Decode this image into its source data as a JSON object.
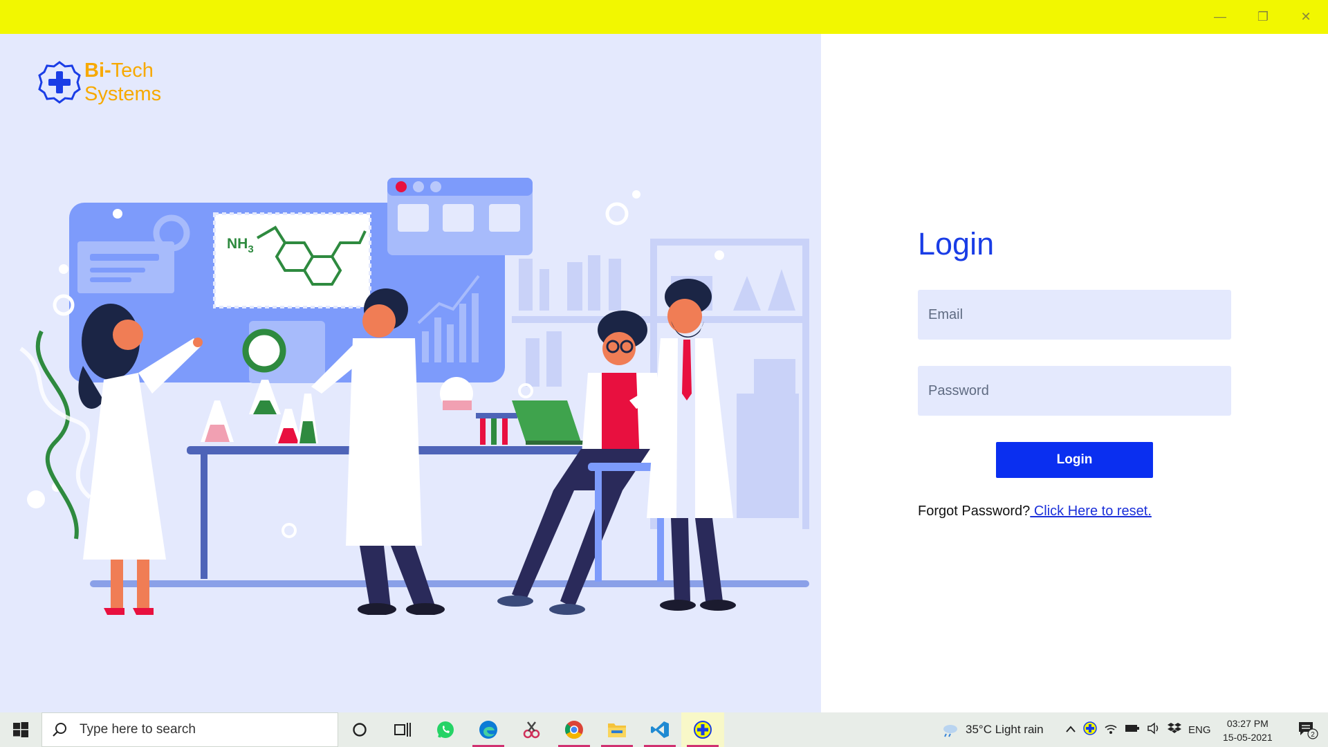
{
  "window": {
    "controls": {
      "minimize": "—",
      "maximize": "❐",
      "close": "✕"
    }
  },
  "brand": {
    "name_part1": "Bi-",
    "name_part2": "Tech",
    "name_line2": "Systems"
  },
  "illustration": {
    "formula_label": "NH",
    "formula_subscript": "3"
  },
  "login": {
    "title": "Login",
    "email_placeholder": "Email",
    "password_placeholder": "Password",
    "button_label": "Login",
    "forgot_text": "Forgot Password?",
    "reset_link": " Click Here to reset."
  },
  "taskbar": {
    "search_placeholder": "Type here to search",
    "weather_text": "35°C  Light rain",
    "language": "ENG",
    "time": "03:27 PM",
    "date": "15-05-2021",
    "notification_count": "2"
  },
  "colors": {
    "titlebar": "#f2f700",
    "left_pane": "#e4e9fd",
    "accent_blue": "#0a2ff0",
    "brand_orange": "#f7a900"
  }
}
